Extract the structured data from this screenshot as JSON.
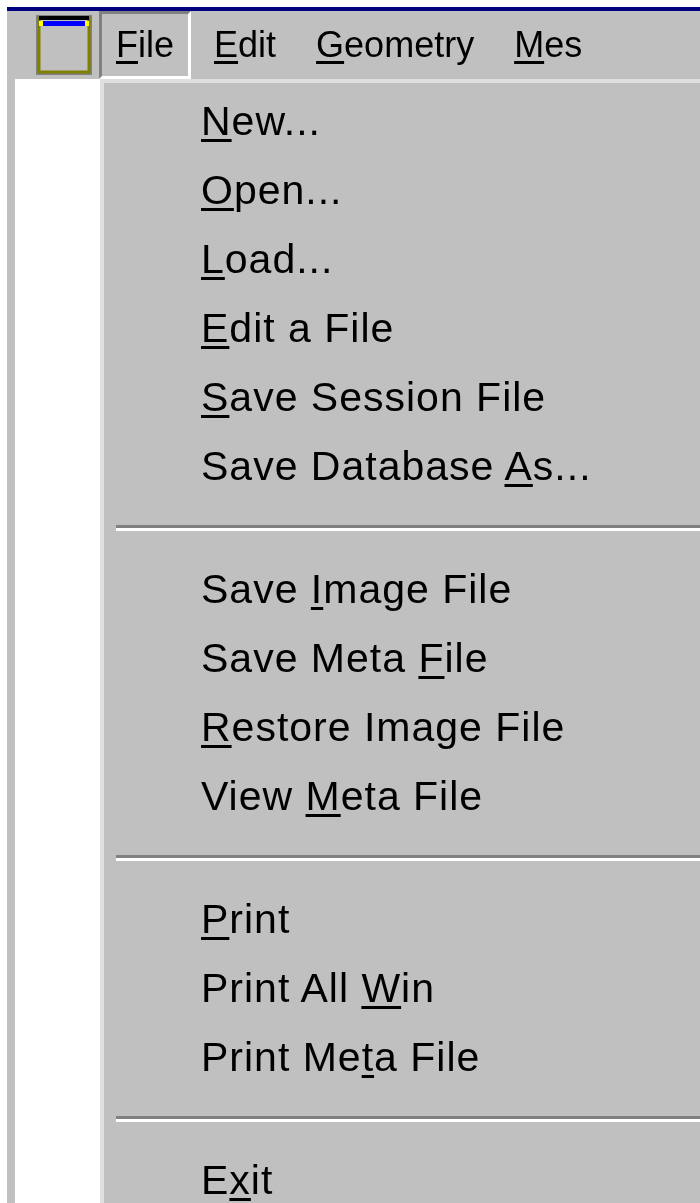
{
  "menubar": [
    {
      "label": {
        "key": "F",
        "after": "ile"
      },
      "selected": true
    },
    {
      "label": {
        "key": "E",
        "after": "dit"
      },
      "selected": false
    },
    {
      "label": {
        "key": "G",
        "after": "eometry"
      },
      "selected": false
    },
    {
      "label": {
        "key": "M",
        "after": "es"
      },
      "selected": false
    }
  ],
  "file_menu": [
    {
      "kind": "item",
      "label": {
        "key": "N",
        "after": "ew..."
      }
    },
    {
      "kind": "item",
      "label": {
        "key": "O",
        "after": "pen..."
      }
    },
    {
      "kind": "item",
      "label": {
        "key": "L",
        "after": "oad..."
      }
    },
    {
      "kind": "item",
      "label": {
        "key": "E",
        "after": "dit a File"
      }
    },
    {
      "kind": "item",
      "label": {
        "key": "S",
        "after": "ave Session File"
      }
    },
    {
      "kind": "item",
      "label": {
        "before": "Save Database ",
        "key": "A",
        "after": "s..."
      }
    },
    {
      "kind": "separator"
    },
    {
      "kind": "item",
      "label": {
        "before": "Save ",
        "key": "I",
        "after": "mage File"
      }
    },
    {
      "kind": "item",
      "label": {
        "before": "Save Meta ",
        "key": "F",
        "after": "ile"
      }
    },
    {
      "kind": "item",
      "label": {
        "key": "R",
        "after": "estore Image File"
      }
    },
    {
      "kind": "item",
      "label": {
        "before": "View ",
        "key": "M",
        "after": "eta File"
      }
    },
    {
      "kind": "separator"
    },
    {
      "kind": "item",
      "label": {
        "key": "P",
        "after": "rint"
      }
    },
    {
      "kind": "item",
      "label": {
        "before": "Print All ",
        "key": "W",
        "after": "in"
      }
    },
    {
      "kind": "item",
      "label": {
        "before": "Print Me",
        "key": "t",
        "after": "a File"
      }
    },
    {
      "kind": "separator"
    },
    {
      "kind": "item",
      "label": {
        "before": "E",
        "key": "x",
        "after": "it"
      }
    }
  ]
}
